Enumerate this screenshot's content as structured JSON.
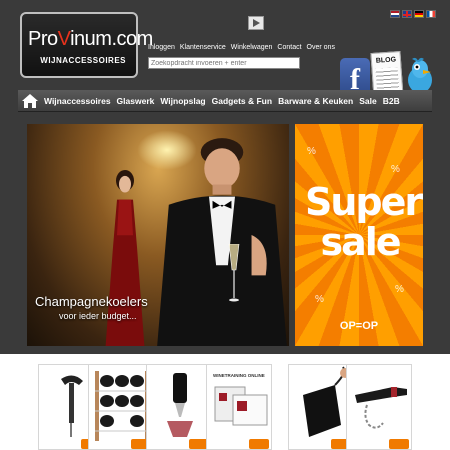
{
  "logo": {
    "prefix": "Pro",
    "v": "V",
    "suffix": "inum.com",
    "sub": "WIJNACCESSOIRES"
  },
  "languages": [
    "nl",
    "en",
    "de",
    "fr"
  ],
  "toplinks": [
    "Inloggen",
    "Klantenservice",
    "Winkelwagen",
    "Contact",
    "Over ons"
  ],
  "search": {
    "placeholder": "Zoekopdracht invoeren + enter"
  },
  "social": {
    "blog_label": "BLOG"
  },
  "nav": [
    "Wijnaccessoires",
    "Glaswerk",
    "Wijnopslag",
    "Gadgets & Fun",
    "Barware & Keuken",
    "Sale",
    "B2B"
  ],
  "banner": {
    "title": "Champagnekoelers",
    "subtitle": "voor ieder budget..."
  },
  "sale": {
    "line1": "Super",
    "line2": "sale",
    "footer": "OP=OP"
  },
  "products": [
    {
      "name": "corkscrew"
    },
    {
      "name": "wine-rack"
    },
    {
      "name": "aerator"
    },
    {
      "name": "wine-course",
      "label": "WINETRAINING ONLINE"
    },
    {
      "name": "wine-bag"
    },
    {
      "name": "bottle-chain"
    }
  ],
  "colors": {
    "accent": "#f07a00",
    "logo_red": "#e8321c",
    "nav_bg": "#4a4a4a",
    "page_bg": "#3a3a3a"
  }
}
